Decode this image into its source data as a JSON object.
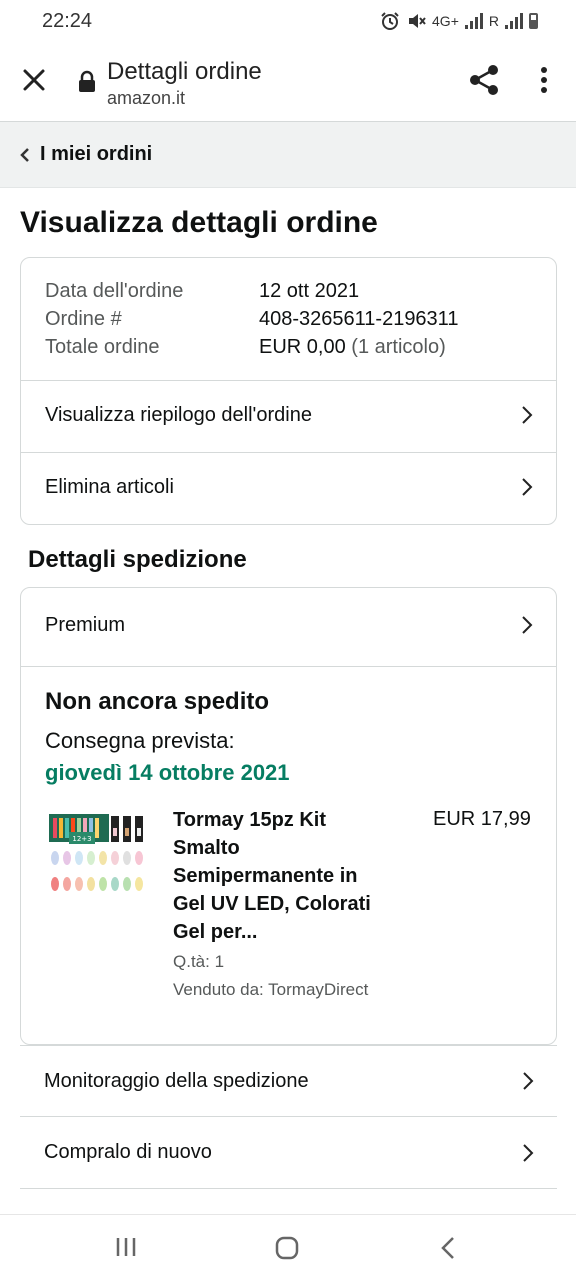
{
  "status_bar": {
    "time": "22:24",
    "network_label": "4G+",
    "roaming_label": "R",
    "icons": [
      "alarm-icon",
      "mute-icon",
      "signal-icon",
      "battery-icon"
    ]
  },
  "browser": {
    "title": "Dettagli ordine",
    "domain": "amazon.it",
    "icons": [
      "close-icon",
      "lock-icon",
      "share-icon",
      "more-icon"
    ]
  },
  "back_link": {
    "label": "I miei ordini"
  },
  "main_title": "Visualizza dettagli ordine",
  "order_summary": {
    "date_label": "Data dell'ordine",
    "date_value": "12 ott 2021",
    "number_label": "Ordine #",
    "number_value": "408-3265611-2196311",
    "total_label": "Totale ordine",
    "total_value": "EUR 0,00",
    "total_items": "(1 articolo)",
    "links": [
      "Visualizza riepilogo dell'ordine",
      "Elimina articoli"
    ]
  },
  "shipping": {
    "section_title": "Dettagli spedizione",
    "shipping_type": "Premium",
    "status": "Non ancora spedito",
    "delivery_label": "Consegna prevista:",
    "delivery_date": "giovedì 14 ottobre 2021",
    "product": {
      "title": "Tormay 15pz Kit Smalto Semipermanente in Gel UV LED, Colorati Gel per...",
      "price": "EUR 17,99",
      "quantity": "Q.tà: 1",
      "seller": "Venduto da: TormayDirect",
      "image_label": "12+3"
    }
  },
  "actions": [
    "Monitoraggio della spedizione",
    "Compralo di nuovo"
  ],
  "colors": {
    "delivery_green": "#067d62",
    "border": "#d5d9d9",
    "text": "#0f1111",
    "muted": "#565959"
  }
}
